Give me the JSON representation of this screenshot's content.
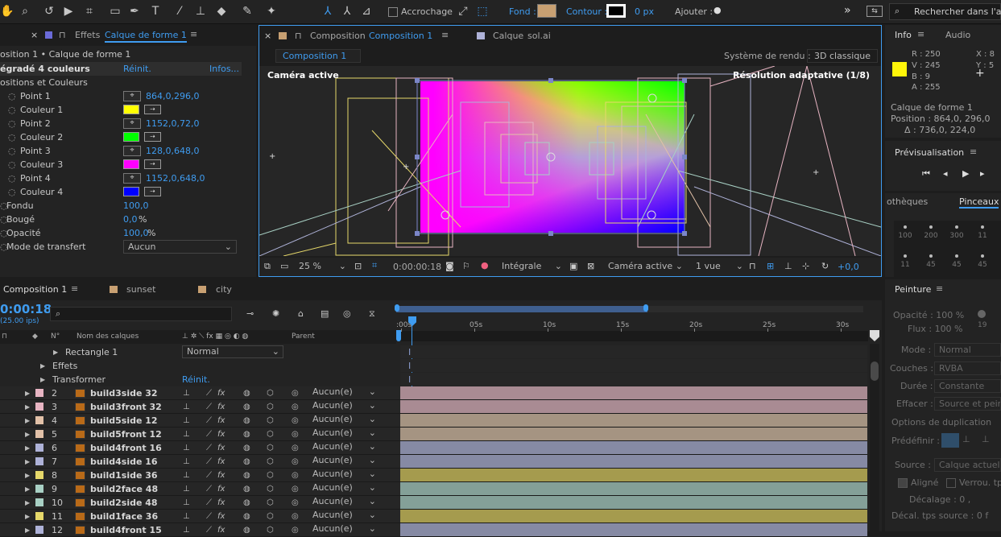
{
  "toolbar": {
    "accrochage_label": "Accrochage",
    "fond_label": "Fond :",
    "fond_color": "#c8a072",
    "contour_label": "Contour :",
    "contour_value": "0 px",
    "ajouter_label": "Ajouter :",
    "search_placeholder": "Rechercher dans l'aide"
  },
  "effects": {
    "tab_prefix": "Effets",
    "tab_layer": "Calque de forme 1",
    "breadcrumb": "osition 1 • Calque de forme 1",
    "effect_name": "égradé 4 couleurs",
    "reinit": "Réinit.",
    "infos": "Infos...",
    "group": "ositions et Couleurs",
    "props": [
      {
        "label": "Point 1",
        "value": "864,0,296,0"
      },
      {
        "label": "Couleur 1",
        "color": "#ffff00"
      },
      {
        "label": "Point 2",
        "value": "1152,0,72,0"
      },
      {
        "label": "Couleur 2",
        "color": "#00ff00"
      },
      {
        "label": "Point 3",
        "value": "128,0,648,0"
      },
      {
        "label": "Couleur 3",
        "color": "#ff00ff"
      },
      {
        "label": "Point 4",
        "value": "1152,0,648,0"
      },
      {
        "label": "Couleur 4",
        "color": "#0000ff"
      }
    ],
    "fondu_label": "Fondu",
    "fondu_value": "100,0",
    "bouge_label": "Bougé",
    "bouge_value": "0,0",
    "bouge_unit": "%",
    "opacite_label": "Opacité",
    "opacite_value": "100,0",
    "opacite_unit": "%",
    "mode_label": "Mode de transfert",
    "mode_value": "Aucun"
  },
  "composition": {
    "tab_prefix": "Composition",
    "tab_name": "Composition 1",
    "tab2_prefix": "Calque",
    "tab2_name": "sol.ai",
    "subtab": "Composition 1",
    "render_label": "Système de rendu :",
    "render_value": "3D classique",
    "camera_label": "Caméra active",
    "resolution_label": "Résolution adaptative (1/8)",
    "zoom": "25 %",
    "timecode": "0:00:00:18",
    "quality": "Intégrale",
    "camera_select": "Caméra active",
    "views": "1 vue",
    "exposure": "+0,0"
  },
  "info": {
    "tab_info": "Info",
    "tab_audio": "Audio",
    "sample_color": "#fff509",
    "r": "R : 250",
    "v": "V : 245",
    "b": "B : 9",
    "a": "A : 255",
    "x": "X : 8",
    "y": "Y : 5",
    "layer": "Calque de forme 1",
    "position": "Position : 864,0, 296,0",
    "delta": "Δ : 736,0, 224,0"
  },
  "preview": {
    "title": "Prévisualisation"
  },
  "brushes": {
    "tab_libs": "othèques",
    "tab_brushes": "Pinceaux",
    "sizes_row1": [
      "100",
      "200",
      "300",
      "11"
    ],
    "sizes_row2": [
      "11",
      "45",
      "45",
      "45"
    ]
  },
  "paint": {
    "title": "Peinture",
    "opacite": "Opacité : 100 %",
    "flux": "Flux : 100 %",
    "brush_size": "19",
    "mode_label": "Mode :",
    "mode_value": "Normal",
    "couches_label": "Couches :",
    "couches_value": "RVBA",
    "duree_label": "Durée :",
    "duree_value": "Constante",
    "effacer_label": "Effacer :",
    "effacer_value": "Source et peint",
    "options": "Options de duplication",
    "predefinir": "Prédéfinir :",
    "source_label": "Source :",
    "source_value": "Calque actuel",
    "aligne": "Aligné",
    "verrou": "Verrou. tps",
    "decalage": "Décalage : 0 ,",
    "decal_tps": "Décal. tps source : 0  f"
  },
  "timeline": {
    "tab_active": "Composition 1",
    "tab2": "sunset",
    "tab3": "city",
    "timecode": "0:00:18",
    "fps": "(25.00 ips)",
    "col_num": "N°",
    "col_name": "Nom des calques",
    "col_parent": "Parent",
    "ruler": [
      ":00s",
      "05s",
      "10s",
      "15s",
      "20s",
      "25s",
      "30s"
    ],
    "sub_rows": [
      {
        "label": "Rectangle 1",
        "extra": "Normal"
      },
      {
        "label": "Effets",
        "extra": ""
      },
      {
        "label": "Transformer",
        "extra": "Réinit."
      }
    ],
    "layers": [
      {
        "num": "2",
        "name": "build3side 32",
        "parent": "Aucun(e)",
        "color": "#e7b4c2",
        "bar": "#a98b93"
      },
      {
        "num": "3",
        "name": "build3front 32",
        "parent": "Aucun(e)",
        "color": "#e7b4c2",
        "bar": "#a98b93"
      },
      {
        "num": "4",
        "name": "build5side 12",
        "parent": "Aucun(e)",
        "color": "#e2c1a8",
        "bar": "#a59482"
      },
      {
        "num": "5",
        "name": "build5front 12",
        "parent": "Aucun(e)",
        "color": "#e2c1a8",
        "bar": "#a59482"
      },
      {
        "num": "6",
        "name": "build4front 16",
        "parent": "Aucun(e)",
        "color": "#aeb2d8",
        "bar": "#868aa4"
      },
      {
        "num": "7",
        "name": "build4side 16",
        "parent": "Aucun(e)",
        "color": "#aeb2d8",
        "bar": "#868aa4"
      },
      {
        "num": "8",
        "name": "build1side 36",
        "parent": "Aucun(e)",
        "color": "#e6d86a",
        "bar": "#a59b4e"
      },
      {
        "num": "9",
        "name": "build2face 48",
        "parent": "Aucun(e)",
        "color": "#a8d0c4",
        "bar": "#84a098"
      },
      {
        "num": "10",
        "name": "build2side 48",
        "parent": "Aucun(e)",
        "color": "#a8d0c4",
        "bar": "#84a098"
      },
      {
        "num": "11",
        "name": "build1face 36",
        "parent": "Aucun(e)",
        "color": "#e6d86a",
        "bar": "#a59b4e"
      },
      {
        "num": "12",
        "name": "build4front 15",
        "parent": "Aucun(e)",
        "color": "#aeb2d8",
        "bar": "#868aa4"
      }
    ]
  }
}
